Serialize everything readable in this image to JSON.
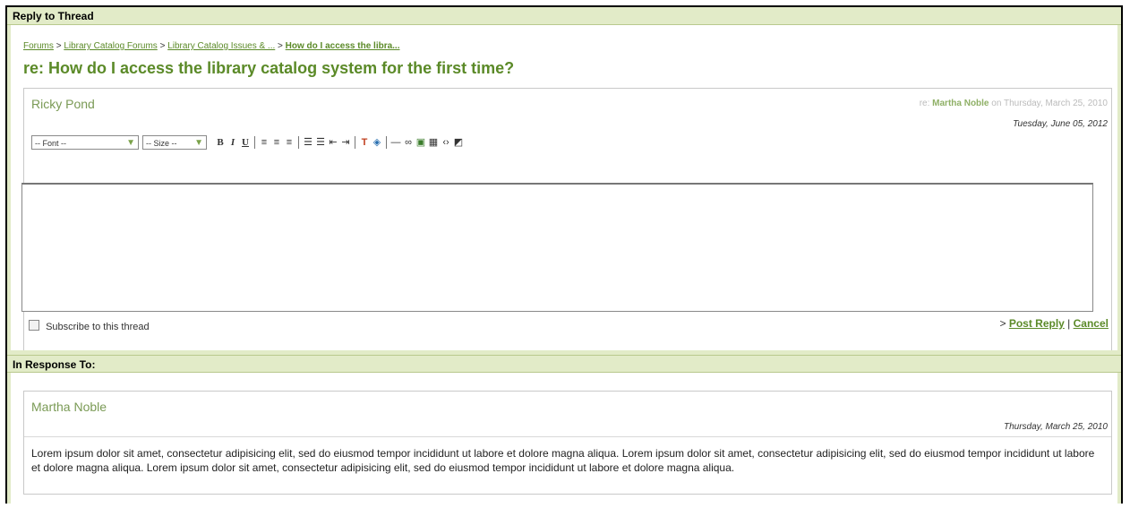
{
  "reply_section": {
    "header": "Reply to Thread",
    "breadcrumb": {
      "items": [
        "Forums",
        "Library Catalog Forums",
        "Library Catalog Issues & ...",
        "How do I access the libra..."
      ],
      "separator": ">"
    },
    "thread_title": "re: How do I access the library catalog system for the first time?",
    "post": {
      "author": "Ricky Pond",
      "re_prefix": "re:",
      "re_author": "Martha Noble",
      "re_on": "on Thursday, March 25, 2010",
      "date": "Tuesday, June 05, 2012"
    },
    "toolbar": {
      "font_select": "-- Font --",
      "size_select": "-- Size --",
      "bold_icon": "B",
      "italic_icon": "I",
      "underline_icon": "U"
    },
    "subscribe_label": "Subscribe to this thread",
    "actions": {
      "prefix": ">",
      "post_reply": "Post Reply",
      "separator": "|",
      "cancel": "Cancel"
    }
  },
  "response_section": {
    "header": "In Response To:",
    "post": {
      "author": "Martha Noble",
      "date": "Thursday, March 25, 2010",
      "body": "Lorem ipsum dolor sit amet, consectetur adipisicing elit, sed do eiusmod tempor incididunt ut labore et dolore magna aliqua. Lorem ipsum dolor sit amet, consectetur adipisicing elit, sed do eiusmod tempor incididunt ut labore et dolore magna aliqua. Lorem ipsum dolor sit amet, consectetur adipisicing elit, sed do eiusmod tempor incididunt ut labore et dolore magna aliqua."
    }
  },
  "colors": {
    "header_bg": "#e2ebc8",
    "accent_green": "#5b8a28",
    "author_green": "#7a9a55"
  }
}
